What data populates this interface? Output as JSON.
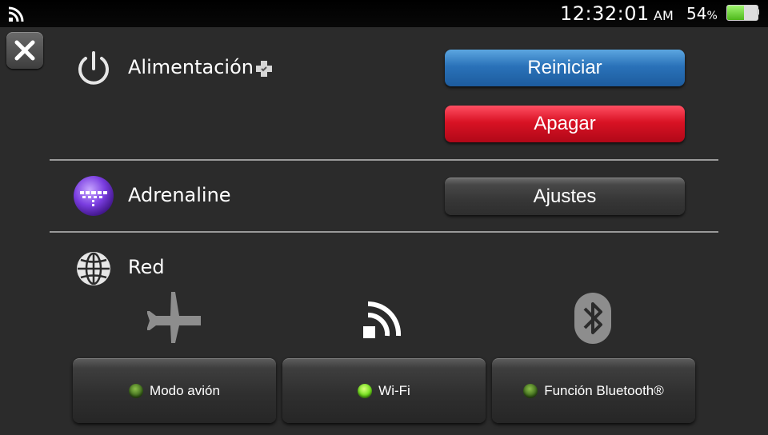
{
  "status_bar": {
    "wifi_icon": "wifi-signal-icon",
    "time": "12:32:01",
    "ampm": "AM",
    "battery_percent": "54",
    "percent_sign": "%",
    "battery_level": 0.54,
    "battery_color": "#6fd32f"
  },
  "close_button": {
    "icon": "close-x-icon"
  },
  "power": {
    "label": "Alimentación",
    "icon": "power-icon",
    "badge_icon": "plugin-badge-icon",
    "restart_label": "Reiniciar",
    "shutdown_label": "Apagar"
  },
  "adrenaline": {
    "label": "Adrenaline",
    "icon": "adrenaline-icon",
    "settings_label": "Ajustes"
  },
  "network": {
    "label": "Red",
    "icon": "globe-icon",
    "toggles": [
      {
        "label": "Modo avión",
        "icon": "airplane-icon",
        "active": false
      },
      {
        "label": "Wi-Fi",
        "icon": "wifi-icon",
        "active": true
      },
      {
        "label": "Función Bluetooth®",
        "icon": "bluetooth-icon",
        "active": false
      }
    ]
  },
  "colors": {
    "restart": "#2a72b9",
    "shutdown": "#d91224",
    "led_on": "#72e01c",
    "led_off": "#3e6a1c"
  }
}
